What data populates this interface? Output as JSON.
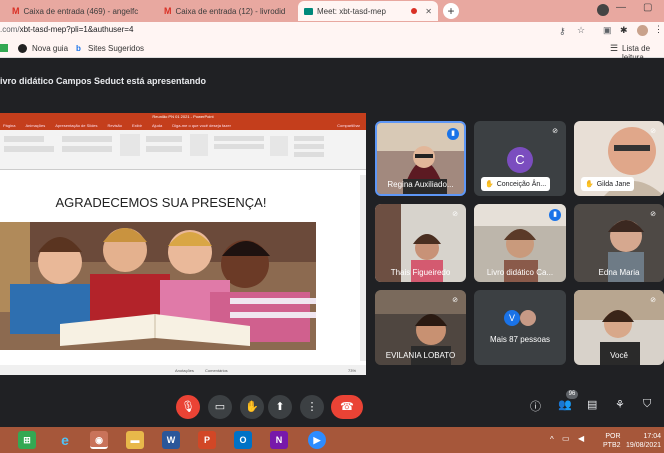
{
  "browser": {
    "tabs": [
      {
        "label": "Caixa de entrada (469) - angelfc",
        "icon": "gmail-icon"
      },
      {
        "label": "Caixa de entrada (12) - livrodid",
        "icon": "gmail-icon"
      },
      {
        "label": "Meet: xbt-tasd-mep",
        "icon": "meet-icon"
      }
    ],
    "url_prefix": ".com/",
    "url_rest": "xbt-tasd-mep?pli=1&authuser=4",
    "bookmarks": [
      "Nova guia",
      "Sites Sugeridos"
    ],
    "reading_list": "Lista de leitura"
  },
  "meet": {
    "presenting_banner": "ivro didático Campos Seduct está apresentando",
    "presentation": {
      "app_title": "Reunião PN 01 2021 - PowerPoint",
      "menu": [
        "Página",
        "Animações",
        "Apresentação de Slides",
        "Revisão",
        "Exibir",
        "Ajuda",
        "Diga-me o que você deseja fazer",
        "Compartilhar"
      ],
      "slide_title": "AGRADECEMOS SUA PRESENÇA!",
      "status_left": "Anotações",
      "status_mid": "Comentários",
      "zoom": "73%"
    },
    "participants": [
      {
        "name": "Regina Auxiliado...",
        "mic": "active"
      },
      {
        "name": "Conceição Ân...",
        "initial": "C",
        "mic": "muted"
      },
      {
        "name": "Gilda Jane",
        "mic": "muted"
      },
      {
        "name": "Thais Figueiredo",
        "mic": "muted"
      },
      {
        "name": "Livro didático Ca...",
        "mic": "active"
      },
      {
        "name": "Edna Maria",
        "mic": "muted"
      },
      {
        "name": "EVILANIA LOBATO",
        "mic": "muted"
      },
      {
        "name": "Mais 87 pessoas",
        "initial": "V"
      },
      {
        "name": "Você",
        "mic": "muted"
      }
    ],
    "people_count": "96"
  },
  "taskbar": {
    "lang": "POR",
    "layout": "PTB2",
    "time": "17:04",
    "date": "19/08/2021"
  },
  "colors": {
    "accent": "#1a73e8",
    "danger": "#ea4335",
    "tile": "#3c4043"
  }
}
